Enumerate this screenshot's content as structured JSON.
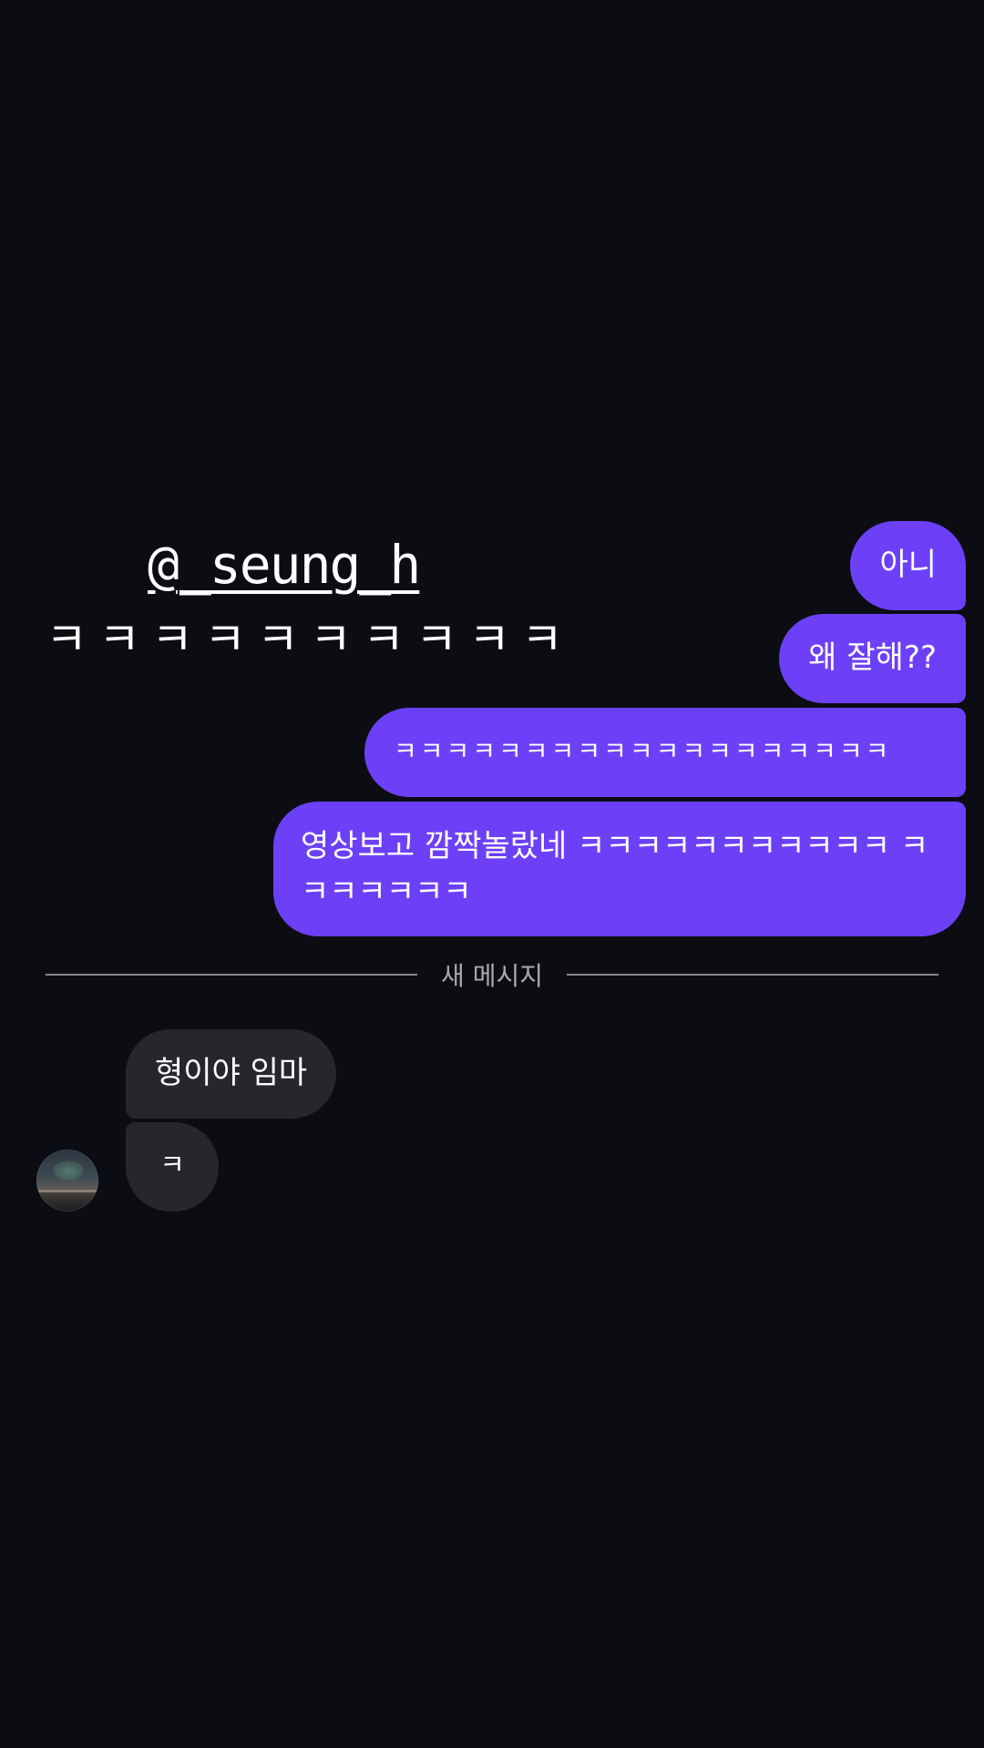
{
  "story_overlay": {
    "mention_icon": "threads-icon",
    "mention": "_seung_h",
    "laugh_text": "ㅋㅋㅋㅋㅋㅋㅋㅋㅋㅋ"
  },
  "outgoing_messages": [
    {
      "text": "아니"
    },
    {
      "text": "왜 잘해??"
    },
    {
      "text": "ㅋㅋㅋㅋㅋㅋㅋㅋㅋㅋㅋㅋㅋㅋㅋㅋㅋㅋㅋ"
    },
    {
      "text": "영상보고 깜짝놀랐네 ㅋㅋㅋㅋㅋㅋㅋㅋㅋㅋㅋ ㅋㅋㅋㅋㅋㅋㅋ"
    }
  ],
  "divider": {
    "label": "새 메시지"
  },
  "incoming_messages": [
    {
      "text": "형이야 임마"
    },
    {
      "text": "ㅋ"
    }
  ],
  "colors": {
    "background": "#0c0d13",
    "outgoing_bubble": "#6d40f8",
    "incoming_bubble": "#26272d",
    "divider_line": "#8a8b90"
  }
}
